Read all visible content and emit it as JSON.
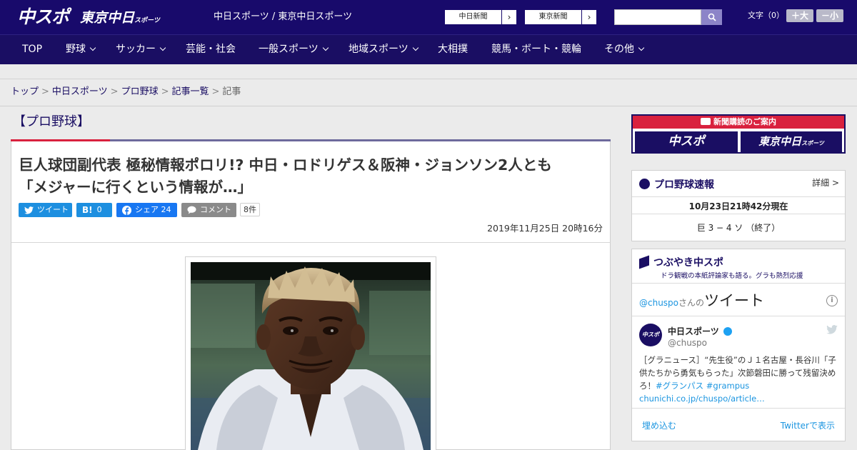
{
  "header": {
    "logo_main": "中スポ",
    "logo_tokyo": "東京中日",
    "logo_tokyo_small": "スポーツ",
    "site_subtitle": "中日スポーツ / 東京中日スポーツ",
    "paper_links": [
      {
        "label": "中日新聞",
        "arrow": "›"
      },
      {
        "label": "東京新聞",
        "arrow": "›"
      }
    ],
    "search_value": "",
    "font_size_label": "文字（0）",
    "font_larger": "＋大",
    "font_smaller": "－小"
  },
  "nav": {
    "items": [
      {
        "label": "TOP",
        "dropdown": false
      },
      {
        "label": "野球",
        "dropdown": true
      },
      {
        "label": "サッカー",
        "dropdown": true
      },
      {
        "label": "芸能・社会",
        "dropdown": false
      },
      {
        "label": "一般スポーツ",
        "dropdown": true
      },
      {
        "label": "地域スポーツ",
        "dropdown": true
      },
      {
        "label": "大相撲",
        "dropdown": false
      },
      {
        "label": "競馬・ボート・競輪",
        "dropdown": false
      },
      {
        "label": "その他",
        "dropdown": true
      }
    ]
  },
  "breadcrumb": {
    "items": [
      "トップ",
      "中日スポーツ",
      "プロ野球",
      "記事一覧"
    ],
    "current": "記事",
    "separator": ">"
  },
  "article": {
    "section": "【プロ野球】",
    "headline_line1": "巨人球団副代表 極秘情報ポロリ!? 中日・ロドリゲス＆阪神・ジョンソン2人とも",
    "headline_line2": "「メジャーに行くという情報が…」",
    "share": {
      "tweet_label": "ツイート",
      "hatena_label": "B!",
      "hatena_count": "0",
      "facebook_label": "シェア",
      "facebook_count": "24",
      "comment_label": "コメント",
      "comment_count": "8件"
    },
    "date": "2019年11月25日 20時16分"
  },
  "sidebar": {
    "subscribe": {
      "header": "新聞購読のご案内",
      "chuspo": "中スポ",
      "tokyo": "東京中日",
      "tokyo_small": "スポーツ"
    },
    "baseball_flash": {
      "title": "プロ野球速報",
      "detail": "詳細 >",
      "timestamp": "10月23日21時42分現在",
      "score": "巨 3 − 4 ソ （終了）"
    },
    "tsubuyaki": {
      "title": "つぶやき中スポ",
      "subtitle": "ドラ観戦の本紙評論家も語る。グラも熱烈応援",
      "handle_prefix": "@chuspo",
      "handle_suffix": "さんの",
      "tweets_word": "ツイート",
      "info_icon": "i",
      "account_name": "中日スポーツ",
      "account_handle": "@chuspo",
      "avatar_text": "中スポ",
      "tweet_text": "［グラニュース］“先生役”のＪ１名古屋・長谷川「子供たちから勇気もらった」次節磐田に勝って残留決めろ！",
      "hashtag_1": "#グランパス",
      "hashtag_2": "#grampus",
      "tweet_link": "chunichi.co.jp/chuspo/article…",
      "embed": "埋め込む",
      "view_on_twitter": "Twitterで表示"
    }
  },
  "colors": {
    "header_bg": "#180a6b",
    "nav_bg": "#1a0e63",
    "accent_red": "#d9213e",
    "twitter_blue": "#1d8fe0",
    "hatena_blue": "#1d8fe0",
    "facebook_blue": "#1877f2",
    "comment_gray": "#8a8a8a"
  }
}
